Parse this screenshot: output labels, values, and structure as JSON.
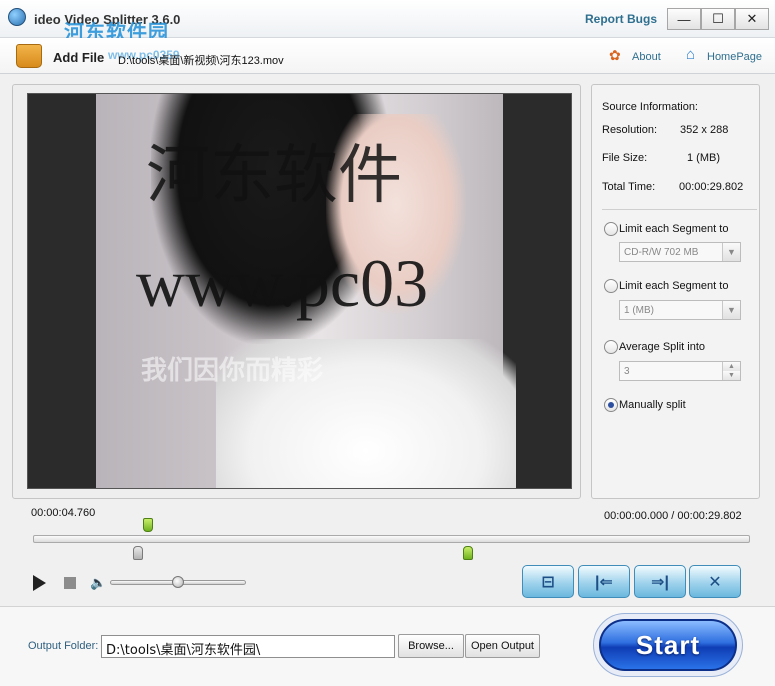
{
  "window": {
    "title": "ideo Video Splitter 3.6.0",
    "report_bugs": "Report Bugs",
    "controls": {
      "minimize": "—",
      "maximize": "☐",
      "close": "✕"
    }
  },
  "watermark": {
    "site_name": "河东软件园",
    "site_url": "www.pc0359",
    "overlay_cn": "河东软件",
    "overlay_url": "www.pc03",
    "overlay_small": "我们因你而精彩"
  },
  "toolbar": {
    "add_file": "Add File",
    "file_path": "D:\\tools\\桌面\\新视频\\河东123.mov",
    "about": "About",
    "homepage": "HomePage"
  },
  "source_info": {
    "heading": "Source Information:",
    "resolution_label": "Resolution:",
    "resolution_value": "352 x 288",
    "filesize_label": "File Size:",
    "filesize_value": "1 (MB)",
    "totaltime_label": "Total Time:",
    "totaltime_value": "00:00:29.802"
  },
  "split_options": {
    "opt1_label": "Limit each Segment to",
    "opt1_value": "CD-R/W 702 MB",
    "opt2_label": "Limit each Segment to",
    "opt2_value": "1 (MB)",
    "opt3_label": "Average Split into",
    "opt3_value": "3",
    "opt4_label": "Manually split",
    "selected": "Manually split"
  },
  "timeline": {
    "current_time": "00:00:04.760",
    "range": "00:00:00.000 / 00:00:29.802",
    "playhead_fraction": 0.16,
    "start_marker_fraction": 0.14,
    "end_marker_fraction": 0.6
  },
  "player": {
    "volume_fraction": 0.5
  },
  "output": {
    "label": "Output Folder:",
    "path": "D:\\tools\\桌面\\河东软件园\\",
    "browse": "Browse...",
    "open_output": "Open Output",
    "start": "Start"
  }
}
